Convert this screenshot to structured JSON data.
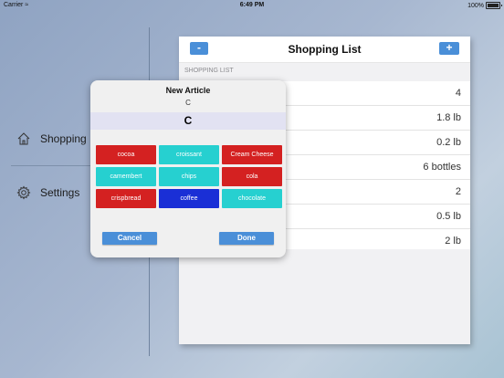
{
  "status_bar": {
    "carrier": "Carrier",
    "time": "6:49 PM",
    "battery": "100%"
  },
  "sidebar": {
    "items": [
      {
        "label": "Shopping",
        "icon": "home-icon"
      },
      {
        "label": "Settings",
        "icon": "gear-icon"
      }
    ]
  },
  "list": {
    "title": "Shopping List",
    "minus_label": "-",
    "plus_label": "+",
    "section_header": "SHOPPING LIST",
    "quantities": [
      "4",
      "1.8 lb",
      "0.2 lb",
      "6 bottles",
      "2",
      "0.5 lb",
      "2 lb"
    ]
  },
  "dialog": {
    "title": "New Article",
    "subtitle": "C",
    "input_value": "C",
    "chips": [
      {
        "label": "cocoa",
        "color": "#d42121"
      },
      {
        "label": "croissant",
        "color": "#26d0d0"
      },
      {
        "label": "Cream Cheese",
        "color": "#d42121"
      },
      {
        "label": "camembert",
        "color": "#26d0d0"
      },
      {
        "label": "chips",
        "color": "#26d0d0"
      },
      {
        "label": "cola",
        "color": "#d42121"
      },
      {
        "label": "crispbread",
        "color": "#d42121"
      },
      {
        "label": "coffee",
        "color": "#1a2fd6"
      },
      {
        "label": "chocolate",
        "color": "#26d0d0"
      }
    ],
    "cancel_label": "Cancel",
    "done_label": "Done"
  },
  "colors": {
    "accent": "#4a8fd8",
    "red_chip": "#d42121",
    "cyan_chip": "#26d0d0",
    "blue_chip": "#1a2fd6"
  }
}
